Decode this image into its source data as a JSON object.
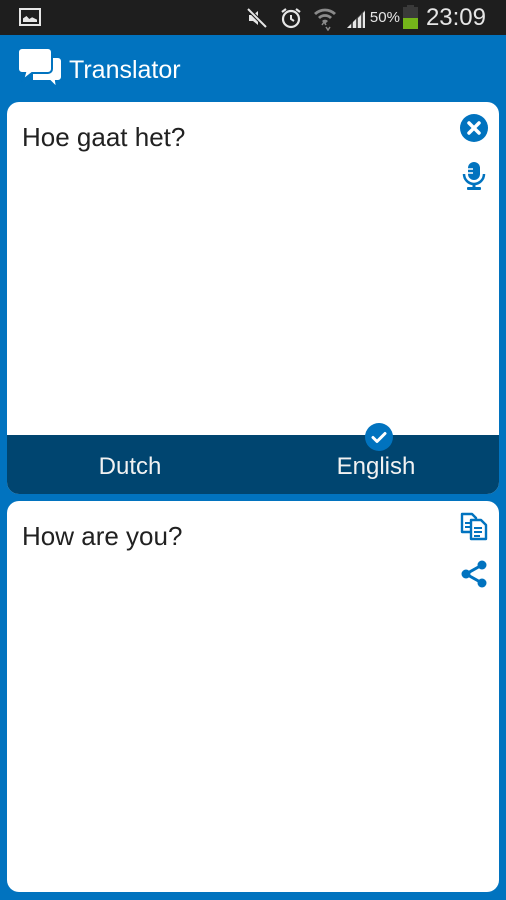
{
  "status_bar": {
    "icons": [
      "image-notification-icon",
      "mute-icon",
      "alarm-icon",
      "wifi-icon",
      "signal-icon"
    ],
    "battery_percent_label": "50%",
    "battery_level": 0.5,
    "time": "23:09"
  },
  "app_bar": {
    "icon": "chat-bubbles-icon",
    "title": "Translator"
  },
  "source_panel": {
    "text": "Hoe gaat het?",
    "actions": [
      {
        "name": "clear",
        "icon": "close-circle-icon"
      },
      {
        "name": "voice-input",
        "icon": "microphone-icon"
      }
    ]
  },
  "language_bar": {
    "source_language": "Dutch",
    "target_language": "English",
    "selected": "English",
    "selected_icon": "check-circle-icon"
  },
  "result_panel": {
    "text": "How are you?",
    "actions": [
      {
        "name": "copy",
        "icon": "copy-icon"
      },
      {
        "name": "share",
        "icon": "share-icon"
      }
    ]
  },
  "colors": {
    "primary": "#0173bf",
    "language_bar": "#004570",
    "status_bar": "#1e1e1e",
    "battery": "#74b51a"
  }
}
